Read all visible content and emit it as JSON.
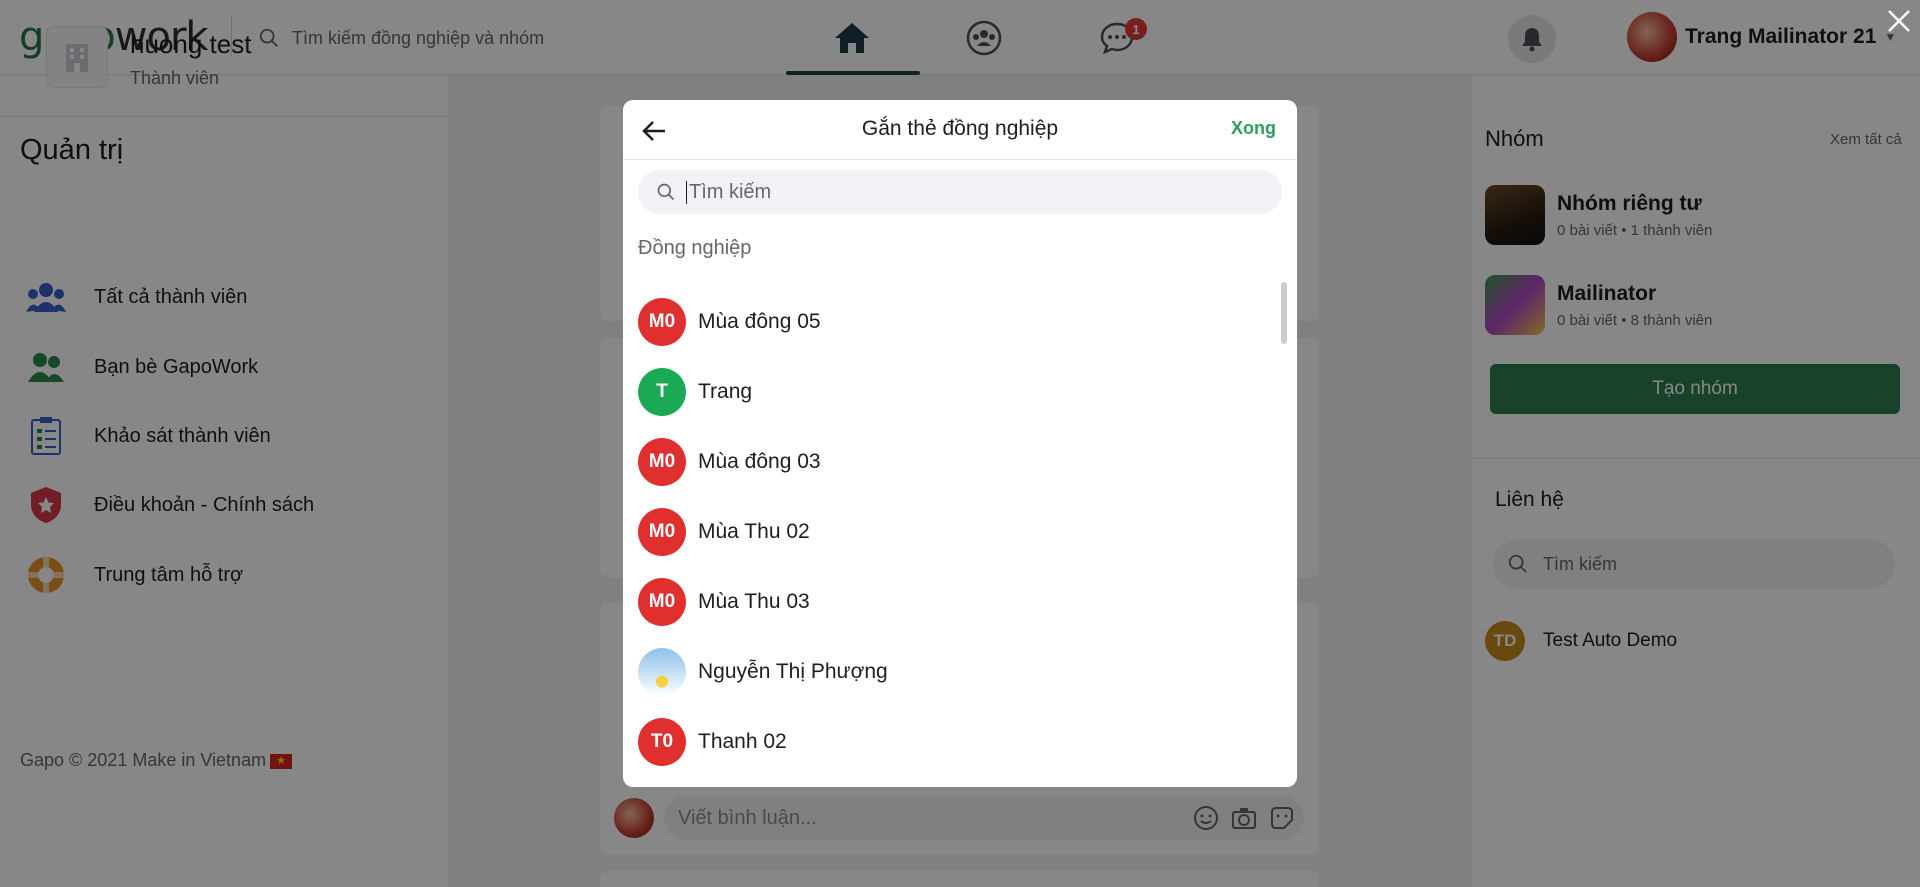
{
  "topbar": {
    "logo_part1": "gapo",
    "logo_part2": "work",
    "search_placeholder": "Tìm kiếm đồng nghiệp và nhóm",
    "chat_badge": "1",
    "user_name": "Trang Mailinator 21"
  },
  "left": {
    "org_name": "huong test",
    "org_role": "Thành viên",
    "admin_title": "Quản trị",
    "menu": [
      {
        "label": "Tất cả thành viên",
        "icon": "members-icon"
      },
      {
        "label": "Bạn bè GapoWork",
        "icon": "friends-icon"
      },
      {
        "label": "Khảo sát thành viên",
        "icon": "survey-icon"
      },
      {
        "label": "Điều khoản - Chính sách",
        "icon": "policy-shield-icon"
      },
      {
        "label": "Trung tâm hỗ trợ",
        "icon": "support-lifebuoy-icon"
      }
    ],
    "footer": "Gapo © 2021 Make in Vietnam"
  },
  "feed": {
    "comment_placeholder": "Viết bình luận..."
  },
  "right": {
    "groups_title": "Nhóm",
    "see_all": "Xem tất cả",
    "groups": [
      {
        "name": "Nhóm riêng tư",
        "meta": "0 bài viết  •  1 thành viên"
      },
      {
        "name": "Mailinator",
        "meta": "0 bài viết  •  8 thành viên"
      }
    ],
    "create_group": "Tạo nhóm",
    "contacts_title": "Liên hệ",
    "contacts_search": "Tìm kiếm",
    "contacts": [
      {
        "initials": "TD",
        "name": "Test Auto Demo"
      }
    ]
  },
  "modal": {
    "title": "Gắn thẻ đồng nghiệp",
    "done": "Xong",
    "search_placeholder": "Tìm kiếm",
    "section": "Đồng nghiệp",
    "colleagues": [
      {
        "initials": "M0",
        "name": "Mùa đông 05",
        "color": "#e02f2f"
      },
      {
        "initials": "T",
        "name": "Trang",
        "color": "#1aaa55"
      },
      {
        "initials": "M0",
        "name": "Mùa đông 03",
        "color": "#e02f2f"
      },
      {
        "initials": "M0",
        "name": "Mùa Thu 02",
        "color": "#e02f2f"
      },
      {
        "initials": "M0",
        "name": "Mùa Thu 03",
        "color": "#e02f2f"
      },
      {
        "initials": "",
        "name": "Nguyễn Thị Phượng",
        "color": "photo"
      },
      {
        "initials": "T0",
        "name": "Thanh 02",
        "color": "#e02f2f"
      }
    ]
  }
}
